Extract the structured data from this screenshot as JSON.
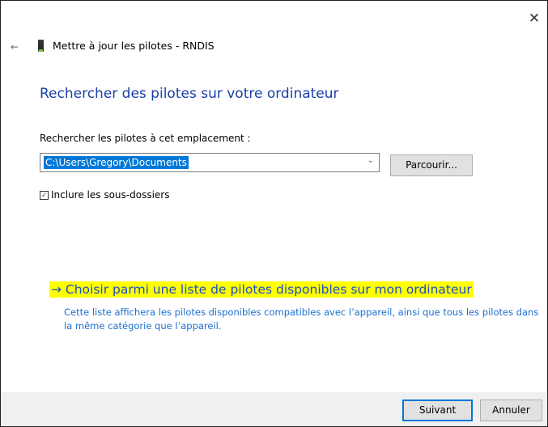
{
  "window": {
    "close_glyph": "✕",
    "back_glyph": "←",
    "title": "Mettre à jour les pilotes - RNDIS"
  },
  "main": {
    "heading": "Rechercher des pilotes sur votre ordinateur",
    "location_label": "Rechercher les pilotes à cet emplacement :",
    "path_value": "C:\\Users\\Gregory\\Documents",
    "browse_label": "Parcourir...",
    "include_subfolders_label": "Inclure les sous-dossiers",
    "include_subfolders_checked": true,
    "choose_link": "→ Choisir parmi une liste de pilotes disponibles sur mon ordinateur",
    "choose_description": "Cette liste affichera les pilotes disponibles compatibles avec l’appareil, ainsi que tous les pilotes dans la même catégorie que l’appareil."
  },
  "footer": {
    "next_label": "Suivant",
    "cancel_label": "Annuler"
  },
  "colors": {
    "heading": "#1a3fa8",
    "link": "#1a4fc4",
    "highlight": "#ffff00",
    "selection": "#0078d7"
  },
  "icons": {
    "device": "device-icon",
    "close": "close-icon",
    "back": "back-arrow-icon",
    "dropdown": "chevron-down-icon",
    "check": "checkbox-check-icon"
  }
}
